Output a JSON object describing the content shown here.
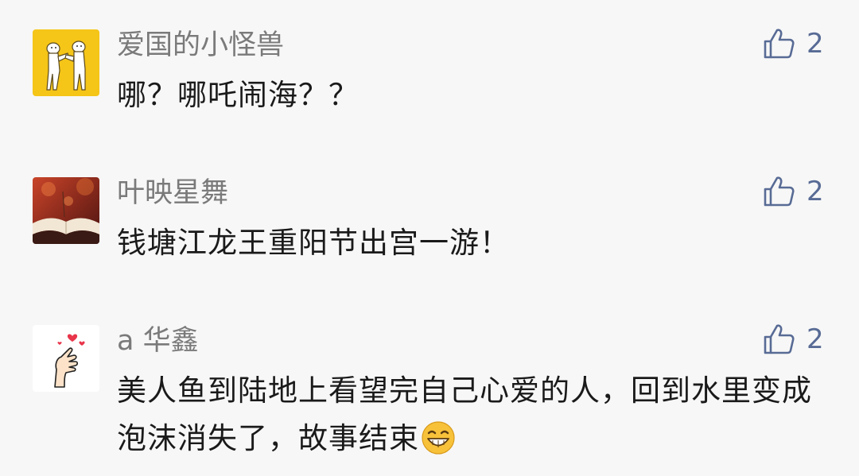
{
  "comments": [
    {
      "username": "爱国的小怪兽",
      "text": "哪？哪吒闹海？？",
      "likes": "2",
      "avatar_icon": "cartoon-cats-dancing-avatar",
      "avatar_bg": "#f5c518"
    },
    {
      "username": "叶映星舞",
      "text": "钱塘江龙王重阳节出宫一游！",
      "likes": "2",
      "avatar_icon": "open-book-autumn-avatar",
      "avatar_bg": "#8a2a1c"
    },
    {
      "username": "a 华鑫",
      "text": "美人鱼到陆地上看望完自己心爱的人，回到水里变成泡沫消失了，故事结束",
      "likes": "2",
      "avatar_icon": "finger-heart-hand-avatar",
      "avatar_bg": "#ffffff",
      "trailing_emoji": "grinning-face-emoji"
    }
  ],
  "colors": {
    "background": "#f7f7f7",
    "username": "#7a7a7a",
    "text": "#1a1a1a",
    "like": "#586b95"
  },
  "like_icon": "thumbs-up-icon"
}
